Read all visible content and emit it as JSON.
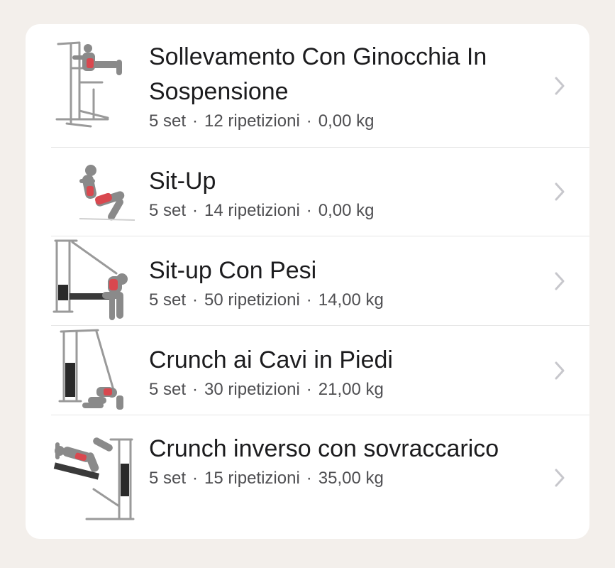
{
  "exercises": [
    {
      "name": "Sollevamento Con Ginocchia In Sospensione",
      "sets": "5 set",
      "reps": "12 ripetizioni",
      "weight": "0,00 kg",
      "illustration": "hanging-knee-raise-icon"
    },
    {
      "name": "Sit-Up",
      "sets": "5 set",
      "reps": "14 ripetizioni",
      "weight": "0,00 kg",
      "illustration": "sit-up-icon"
    },
    {
      "name": "Sit-up Con Pesi",
      "sets": "5 set",
      "reps": "50 ripetizioni",
      "weight": "14,00 kg",
      "illustration": "weighted-sit-up-icon"
    },
    {
      "name": "Crunch ai Cavi in Piedi",
      "sets": "5 set",
      "reps": "30 ripetizioni",
      "weight": "21,00 kg",
      "illustration": "cable-crunch-icon"
    },
    {
      "name": "Crunch inverso con sovraccarico",
      "sets": "5 set",
      "reps": "15 ripetizioni",
      "weight": "35,00 kg",
      "illustration": "weighted-reverse-crunch-icon"
    }
  ],
  "separator": "·",
  "colors": {
    "background": "#f3efeb",
    "card": "#ffffff",
    "title": "#1c1c1e",
    "meta": "#4f4f52",
    "chevron": "#c7c7cc",
    "muscle": "#d9484f"
  }
}
